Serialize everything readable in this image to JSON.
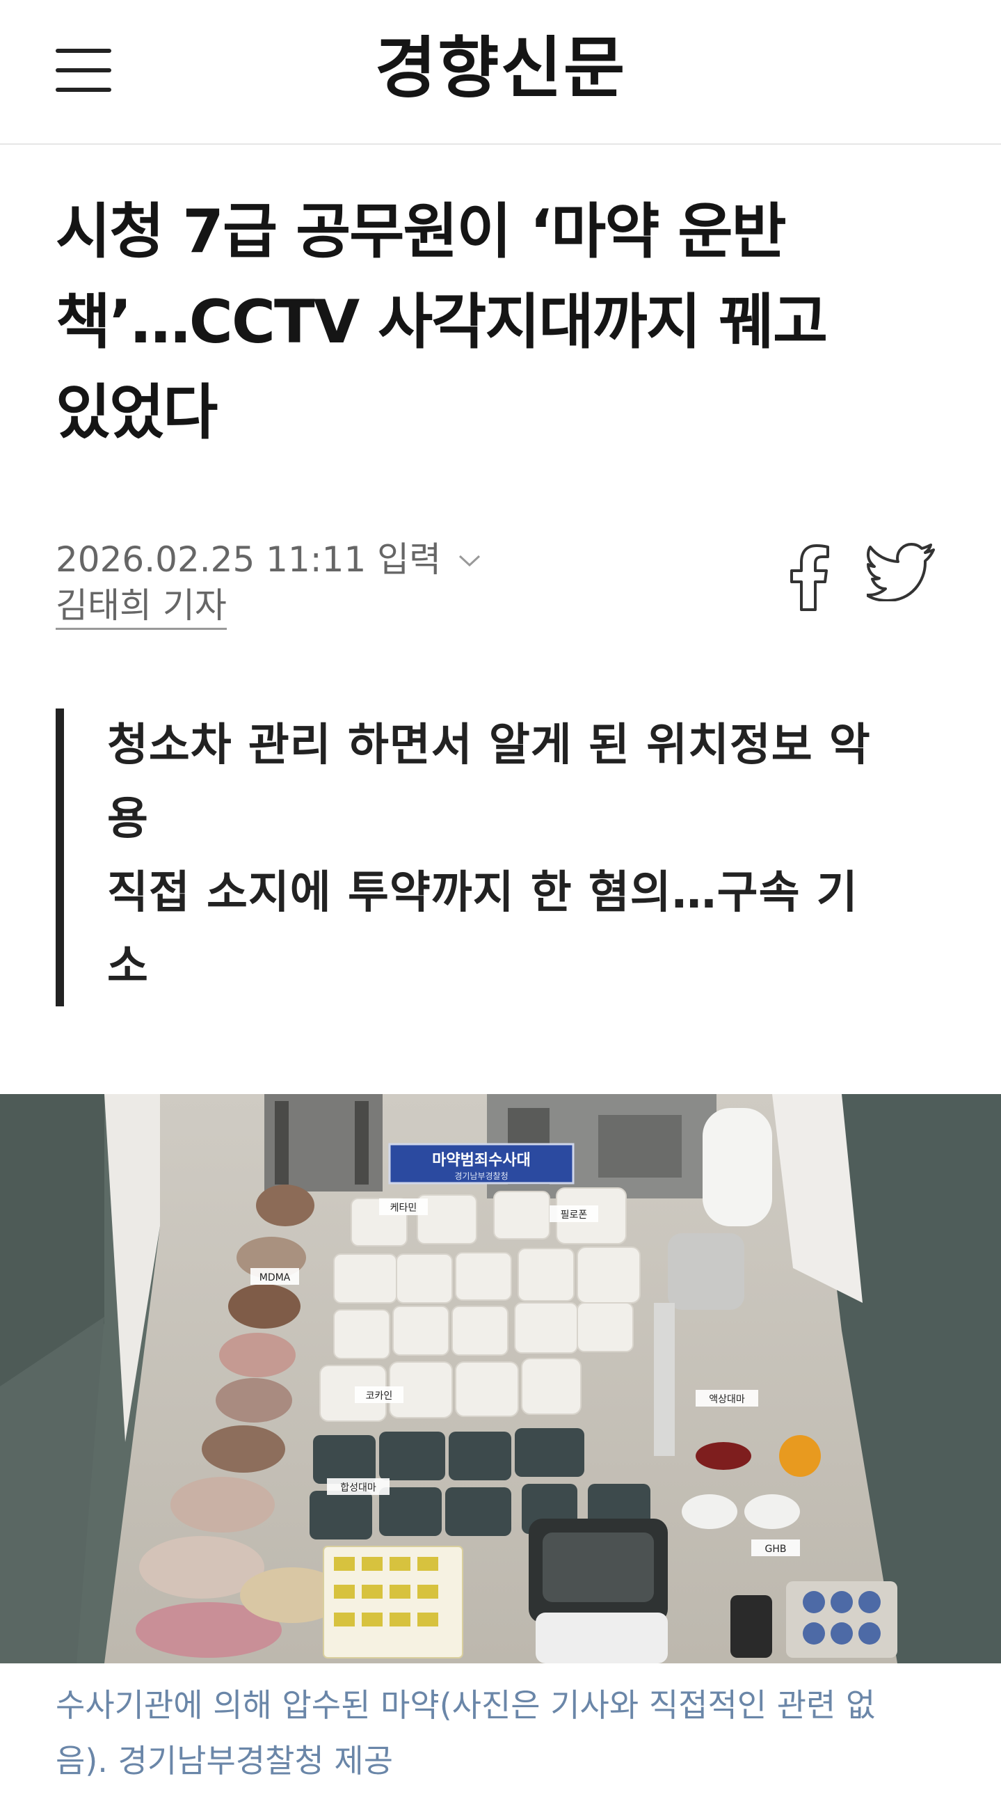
{
  "header": {
    "menu_icon": "hamburger-menu-icon",
    "logo": "경향신문"
  },
  "article": {
    "headline_line1": "시청 7급 공무원이 ‘마약 운반",
    "headline_line2": "책’…CCTV 사각지대까지 꿰고",
    "headline_line3": "있었다",
    "date": "2026.02.25 11:11 입력",
    "author": "김태희 기자",
    "summary": {
      "line1": "청소차 관리 하면서 알게 된 위치정보 악",
      "line2": "용",
      "line3": "직접 소지에 투약까지 한 혐의…구속 기",
      "line4": "소"
    },
    "photo": {
      "banner": "마약범죄수사대",
      "banner_sub": "경기남부경찰청",
      "labels": {
        "ketamine": "케타민",
        "philopon": "필로폰",
        "mdma": "MDMA",
        "cocaine": "코카인",
        "liquid_cannabis": "액상대마",
        "synthetic_cannabis": "합성대마",
        "ghb": "GHB"
      }
    },
    "caption_line1": "수사기관에 의해 압수된 마약(사진은 기사와 직접적인 관련 없",
    "caption_line2": "음). 경기남부경찰청 제공"
  },
  "share": {
    "facebook_icon": "facebook-icon",
    "twitter_icon": "twitter-icon"
  },
  "colors": {
    "caption": "#6a86a8",
    "summary_bar": "#222222",
    "banner": "#2b4aa0"
  }
}
